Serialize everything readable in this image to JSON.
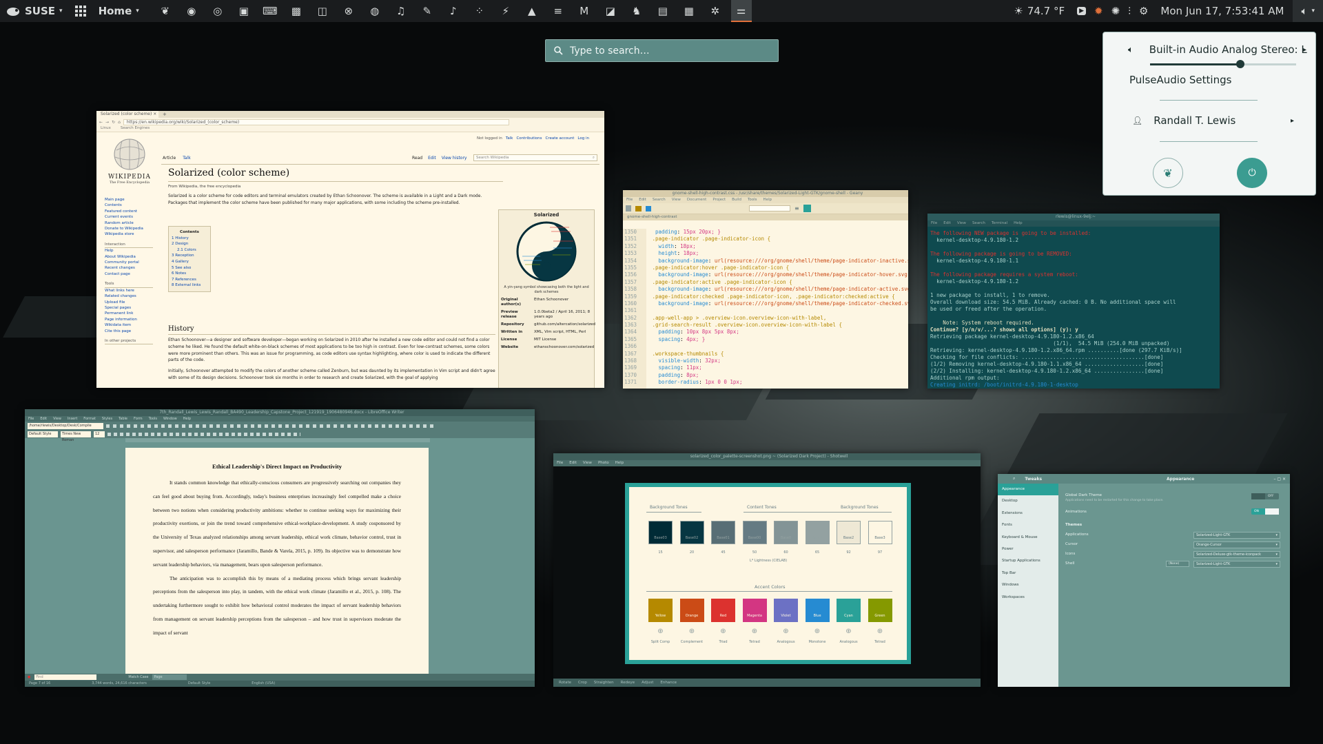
{
  "topbar": {
    "distro": "SUSE",
    "workspace": "Home",
    "weather": "74.7 °F",
    "clock": "Mon Jun 17,  7:53:41 AM",
    "app_icons": [
      "gecko-icon",
      "firefox-icon",
      "chrome-icon",
      "editor-icon",
      "terminal-icon",
      "camera-icon",
      "screenshot-icon",
      "close-circle-icon",
      "browser-icon",
      "headphones-icon",
      "pen-icon",
      "microphone-icon",
      "grid-icon",
      "bolt-icon",
      "vpn-icon",
      "list-icon",
      "gmail-icon",
      "outlook-icon",
      "turtle-icon",
      "bag-icon",
      "document-icon",
      "apps-icon",
      "tweaks-icon"
    ]
  },
  "search": {
    "placeholder": "Type to search…"
  },
  "volume_menu": {
    "output": "Built-in Audio Analog Stereo: L…",
    "level": 0.62,
    "pulse": "PulseAudio Settings",
    "user": "Randall T. Lewis"
  },
  "wikipedia": {
    "tab": "Solarized (color scheme)",
    "url": "https://en.wikipedia.org/wiki/Solarized_(color_scheme)",
    "bookmarks": [
      "Linux",
      "Search Engines"
    ],
    "user_links": [
      "Not logged in",
      "Talk",
      "Contributions",
      "Create account",
      "Log in"
    ],
    "tabs": [
      "Article",
      "Talk"
    ],
    "actions": [
      "Read",
      "Edit",
      "View history"
    ],
    "search": "Search Wikipedia",
    "logo": "WIKIPEDIA",
    "tagline": "The Free Encyclopedia",
    "title": "Solarized (color scheme)",
    "from": "From Wikipedia, the free encyclopedia",
    "intro": "Solarized is a color scheme for code editors and terminal emulators created by Ethan Schoonover. The scheme is available in a Light and a Dark mode. Packages that implement the color scheme have been published for many major applications, with some including the scheme pre-installed.",
    "contents_title": "Contents",
    "contents": [
      "1  History",
      "2  Design",
      "2.1  Colors",
      "3  Reception",
      "4  Gallery",
      "5  See also",
      "6  Notes",
      "7  References",
      "8  External links"
    ],
    "history_heading": "History",
    "history1": "Ethan Schoonover—a designer and software developer—began working on Solarized in 2010 after he installed a new code editor and could not find a color scheme he liked. He found the default white-on-black schemes of most applications to be too high in contrast. Even for low-contrast schemes, some colors were more prominent than others. This was an issue for programming, as code editors use syntax highlighting, where color is used to indicate the different parts of the code.",
    "history2": "Initially, Schoonover attempted to modify the colors of another scheme called Zenburn, but was daunted by its implementation in Vim script and didn't agree with some of its design decisions. Schoonover took six months in order to research and create Solarized, with the goal of applying",
    "sidebar1": [
      "Main page",
      "Contents",
      "Featured content",
      "Current events",
      "Random article",
      "Donate to Wikipedia",
      "Wikipedia store"
    ],
    "interaction_heading": "Interaction",
    "sidebar2": [
      "Help",
      "About Wikipedia",
      "Community portal",
      "Recent changes",
      "Contact page"
    ],
    "tools_heading": "Tools",
    "sidebar3": [
      "What links here",
      "Related changes",
      "Upload file",
      "Special pages",
      "Permanent link",
      "Page information",
      "Wikidata item",
      "Cite this page"
    ],
    "other_projects": "In other projects",
    "infobox_title": "Solarized",
    "caption": "A yin-yang symbol showcasing both the light and dark schemes",
    "infobox": [
      [
        "Original author(s)",
        "Ethan Schoonover"
      ],
      [
        "Preview release",
        "1.0.0beta2 / April 16, 2011; 8 years ago"
      ],
      [
        "Repository",
        "github.com/altercation/solarized"
      ],
      [
        "Written in",
        "XML, Vim script, HTML, Perl"
      ],
      [
        "License",
        "MIT License"
      ],
      [
        "Website",
        "ethanschoonover.com/solarized"
      ]
    ]
  },
  "geany": {
    "title": "gnome-shell-high-contrast.css - /usr/share/themes/Solarized-Light-GTK/gnome-shell - Geany",
    "menu": [
      "File",
      "Edit",
      "Search",
      "View",
      "Document",
      "Project",
      "Build",
      "Tools",
      "Help"
    ],
    "tab": "gnome-shell-high-contrast",
    "lines": [
      {
        "n": "1350",
        "t": "  padding: 15px 20px; }"
      },
      {
        "n": "1351",
        "t": " .page-indicator .page-indicator-icon {"
      },
      {
        "n": "1352",
        "t": "   width: 18px;"
      },
      {
        "n": "1353",
        "t": "   height: 18px;"
      },
      {
        "n": "1354",
        "t": "   background-image: url(resource:///org/gnome/shell/theme/page-indicator-inactive.svg); }"
      },
      {
        "n": "1355",
        "t": " .page-indicator:hover .page-indicator-icon {"
      },
      {
        "n": "1356",
        "t": "   background-image: url(resource:///org/gnome/shell/theme/page-indicator-hover.svg); }"
      },
      {
        "n": "1357",
        "t": " .page-indicator:active .page-indicator-icon {"
      },
      {
        "n": "1358",
        "t": "   background-image: url(resource:///org/gnome/shell/theme/page-indicator-active.svg); }"
      },
      {
        "n": "1359",
        "t": " .page-indicator:checked .page-indicator-icon, .page-indicator:checked:active {"
      },
      {
        "n": "1360",
        "t": "   background-image: url(resource:///org/gnome/shell/theme/page-indicator-checked.svg); }"
      },
      {
        "n": "1361",
        "t": ""
      },
      {
        "n": "1362",
        "t": " .app-well-app > .overview-icon.overview-icon-with-label,"
      },
      {
        "n": "1363",
        "t": " .grid-search-result .overview-icon.overview-icon-with-label {"
      },
      {
        "n": "1364",
        "t": "   padding: 10px 8px 5px 8px;"
      },
      {
        "n": "1365",
        "t": "   spacing: 4px; }"
      },
      {
        "n": "1366",
        "t": ""
      },
      {
        "n": "1367",
        "t": " .workspace-thumbnails {"
      },
      {
        "n": "1368",
        "t": "   visible-width: 32px;"
      },
      {
        "n": "1369",
        "t": "   spacing: 11px;"
      },
      {
        "n": "1370",
        "t": "   padding: 8px;"
      },
      {
        "n": "1371",
        "t": "   border-radius: 1px 0 0 1px;"
      }
    ]
  },
  "terminal": {
    "title": "rlewis@linux-9elj:~",
    "menu": [
      "File",
      "Edit",
      "View",
      "Search",
      "Terminal",
      "Help"
    ],
    "lines": [
      {
        "c": "r",
        "t": "The following NEW package is going to be installed:"
      },
      {
        "c": "n",
        "t": "  kernel-desktop-4.9.180-1.2"
      },
      {
        "c": "n",
        "t": ""
      },
      {
        "c": "r",
        "t": "The following package is going to be REMOVED:"
      },
      {
        "c": "n",
        "t": "  kernel-desktop-4.9.180-1.1"
      },
      {
        "c": "n",
        "t": ""
      },
      {
        "c": "r",
        "t": "The following package requires a system reboot:"
      },
      {
        "c": "n",
        "t": "  kernel-desktop-4.9.180-1.2"
      },
      {
        "c": "n",
        "t": ""
      },
      {
        "c": "n",
        "t": "1 new package to install, 1 to remove."
      },
      {
        "c": "n",
        "t": "Overall download size: 54.5 MiB. Already cached: 0 B. No additional space will"
      },
      {
        "c": "n",
        "t": "be used or freed after the operation."
      },
      {
        "c": "n",
        "t": ""
      },
      {
        "c": "y",
        "t": "    Note: System reboot required."
      },
      {
        "c": "y",
        "t": "Continue? [y/n/v/...? shows all options] (y): y"
      },
      {
        "c": "n",
        "t": "Retrieving package kernel-desktop-4.9.180-1.2.x86_64"
      },
      {
        "c": "n",
        "t": "                                       (1/1),  54.5 MiB (254.0 MiB unpacked)"
      },
      {
        "c": "n",
        "t": "Retrieving: kernel-desktop-4.9.180-1.2.x86_64.rpm ..........[done (297.7 KiB/s)]"
      },
      {
        "c": "n",
        "t": "Checking for file conflicts: .......................................[done]"
      },
      {
        "c": "n",
        "t": "(1/2) Removing kernel-desktop-4.9.180-1.1.x86_64 ...................[done]"
      },
      {
        "c": "n",
        "t": "(2/2) Installing: kernel-desktop-4.9.180-1.2.x86_64 ................[done]"
      },
      {
        "c": "n",
        "t": "Additional rpm output:"
      },
      {
        "c": "b",
        "t": "Creating initrd: /boot/initrd-4.9.180-1-desktop"
      }
    ]
  },
  "writer": {
    "title": "7th_Randall_Lewis_Lewis_Randall_BA490_Leadership_Capstone_Project_121919_1906480946.docx - LibreOffice Writer",
    "menu": [
      "File",
      "Edit",
      "View",
      "Insert",
      "Format",
      "Styles",
      "Table",
      "Form",
      "Tools",
      "Window",
      "Help"
    ],
    "path": "/home/rlewis/Desktop/Desk/Compile",
    "style": "Default Style",
    "font": "Times New Roman",
    "size": "12",
    "doc_title": "Ethical Leadership's Direct Impact on Productivity",
    "para1": "It stands common knowledge that ethically-conscious consumers are progressively searching out companies they can feel good about buying from. Accordingly, today's business enterprises increasingly feel compelled make a choice between two notions when considering productivity ambitions: whether to continue seeking ways for maximizing their productivity exertions, or join the trend toward comprehensive ethical-workplace-development. A study cosponsored by the University of Texas analyzed relationships among servant leadership, ethical work climate, behavior control, trust in supervisor, and salesperson performance (Jaramillo, Bande & Varela, 2015, p. 109). Its objective was to demonstrate how servant leadership behaviors, via management, bears upon salesperson performance.",
    "para2": "The anticipation was to accomplish this by means of a mediating process which brings servant leadership perceptions from the salesperson into play, in tandem, with the ethical work climate (Jaramillo et al., 2015, p. 108). The undertaking furthermore sought to exhibit how behavioral control moderates the impact of servant leadership behaviors from management on servant leadership perceptions from the salesperson – and how trust in supervisors moderate the impact of servant",
    "find": "Find",
    "match": "Match Case",
    "findbar_style": "Page",
    "status": [
      "Page 7 of 16",
      "3,744 words, 24,616 characters",
      "Default Style",
      "English (USA)"
    ]
  },
  "shotwell": {
    "title": "solarized_color_palette-screenshot.png ~ (Solarized Dark Project) - Shotwell",
    "menu": [
      "File",
      "Edit",
      "View",
      "Photo",
      "Help"
    ],
    "bg_tones": "Background Tones",
    "content_tones": "Content Tones",
    "bg_tones2": "Background Tones",
    "bases": [
      {
        "name": "Base03",
        "c": "#002b36",
        "v": "15"
      },
      {
        "name": "Base02",
        "c": "#073642",
        "v": "20"
      },
      {
        "name": "Base01",
        "c": "#586e75",
        "v": "45"
      },
      {
        "name": "Base00",
        "c": "#657b83",
        "v": "50"
      },
      {
        "name": "Base0",
        "c": "#839496",
        "v": "60"
      },
      {
        "name": "Base1",
        "c": "#93a1a1",
        "v": "65"
      },
      {
        "name": "Base2",
        "c": "#eee8d5",
        "v": "92"
      },
      {
        "name": "Base3",
        "c": "#fdf6e3",
        "v": "97"
      }
    ],
    "lightness_note": "L* Lightness (CIELAB)",
    "accent_title": "Accent Colors",
    "accents": [
      {
        "name": "Yellow",
        "c": "#b58900",
        "h": "Split Comp"
      },
      {
        "name": "Orange",
        "c": "#cb4b16",
        "h": "Complement"
      },
      {
        "name": "Red",
        "c": "#dc322f",
        "h": "Triad"
      },
      {
        "name": "Magenta",
        "c": "#d33682",
        "h": "Tetrad"
      },
      {
        "name": "Violet",
        "c": "#6c71c4",
        "h": "Analogous"
      },
      {
        "name": "Blue",
        "c": "#268bd2",
        "h": "Monotone"
      },
      {
        "name": "Cyan",
        "c": "#2aa198",
        "h": "Analogous"
      },
      {
        "name": "Green",
        "c": "#859900",
        "h": "Tetrad"
      }
    ],
    "toolbar": [
      "Rotate",
      "Crop",
      "Straighten",
      "Redeye",
      "Adjust",
      "Enhance"
    ]
  },
  "tweaks": {
    "app": "Tweaks",
    "title": "Appearance",
    "nav": [
      "Appearance",
      "Desktop",
      "Extensions",
      "Fonts",
      "Keyboard & Mouse",
      "Power",
      "Startup Applications",
      "Top Bar",
      "Windows",
      "Workspaces"
    ],
    "global_dark": "Global Dark Theme",
    "global_dark_sub": "Applications need to be restarted for this change to take place.",
    "global_dark_state": "OFF",
    "animations": "Animations",
    "animations_state": "ON",
    "themes": "Themes",
    "rows": [
      {
        "label": "Applications",
        "value": "Solarized-Light-GTK"
      },
      {
        "label": "Cursor",
        "value": "Orange-Cursor"
      },
      {
        "label": "Icons",
        "value": "Solarized-Deluxe-gtk-theme-iconpack"
      },
      {
        "label": "Shell",
        "value": "Solarized-Light-GTK"
      }
    ],
    "shell_none": "(None)"
  }
}
